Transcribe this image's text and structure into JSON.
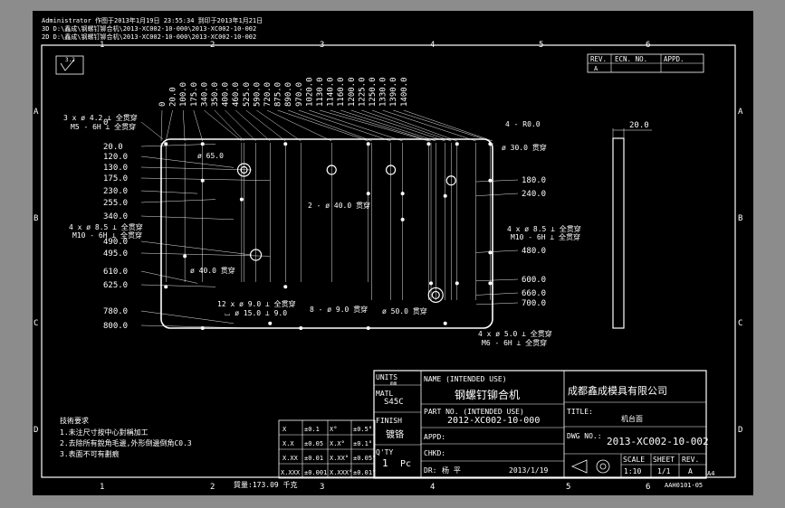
{
  "header": {
    "line1": "Administrator 作图于2013年1月19日 23:55:34 到印于2013年1月21日",
    "line2": "3D  D:\\鑫成\\钢螺钉铆合机\\2013-XC002-10-000\\2013-XC002-10-002",
    "line3": "2D  D:\\鑫成\\钢螺钉铆合机\\2013-XC002-10-000\\2013-XC002-10-002"
  },
  "border": {
    "top_cols": [
      "1",
      "2",
      "3",
      "4",
      "5",
      "6"
    ],
    "bottom_cols": [
      "1",
      "2",
      "3",
      "4",
      "5",
      "6"
    ],
    "left_rows": [
      "A",
      "B",
      "C",
      "D"
    ],
    "right_rows": [
      "A",
      "B",
      "C",
      "D"
    ]
  },
  "surface_mark": "3.2",
  "rev_table": {
    "rev": "REV.",
    "ecn": "ECN. NO.",
    "appd": "APPD.",
    "rev_value": "A"
  },
  "x_dims": [
    "0",
    "20.0",
    "100.0",
    "175.0",
    "340.0",
    "350.0",
    "400.0",
    "460.0",
    "525.0",
    "590.0",
    "720.0",
    "875.0",
    "890.0",
    "970.0",
    "1020.0",
    "1130.0",
    "1140.0",
    "1160.0",
    "1200.0",
    "1225.0",
    "1250.0",
    "1330.0",
    "1390.0",
    "1400.0"
  ],
  "y_dims_left": [
    "0",
    "20.0",
    "120.0",
    "130.0",
    "175.0",
    "230.0",
    "255.0",
    "340.0",
    "490.0",
    "495.0",
    "610.0",
    "625.0",
    "780.0",
    "800.0"
  ],
  "y_dims_right": [
    "180.0",
    "240.0",
    "480.0",
    "600.0",
    "660.0",
    "700.0"
  ],
  "notes": {
    "n1a": "3 x ø 4.2 ⊥ 全贯穿",
    "n1b": "M5 - 6H ⊥ 全贯穿",
    "n2": "4 - R0.0",
    "n3": "ø 30.0 贯穿",
    "n4": "ø 65.0",
    "n5": "2 - ø 40.0 贯穿",
    "n6a": "4 x ø 8.5 ⊥ 全贯穿",
    "n6b": "M10 - 6H ⊥ 全贯穿",
    "n7a": "4 x ø 8.5 ⊥ 全贯穿",
    "n7b": "M10 - 6H ⊥ 全贯穿",
    "n8": "ø 40.0 贯穿",
    "n9a": "12 x ø 9.0 ⊥ 全贯穿",
    "n9b": "⌴ ø 15.0 ⊥ 9.0",
    "n10": "8 - ø 9.0 贯穿",
    "n11": "ø 50.0 贯穿",
    "n12a": "4 x ø 5.0 ⊥ 全贯穿",
    "n12b": "M6 - 6H ⊥ 全贯穿"
  },
  "side_dim": "20.0",
  "tech": {
    "title": "技術要求",
    "l1": "1.未注尺寸按中心對稱加工",
    "l2": "2.去除所有銳角毛邊,外形倒邊倒角C0.3",
    "l3": "3.表面不可有劃痕"
  },
  "weight": "質量:173.09 千克",
  "tol": {
    "r1": [
      "X",
      "±0.1",
      "X°",
      "±0.5°"
    ],
    "r2": [
      "X.X",
      "±0.05",
      "X.X°",
      "±0.1°"
    ],
    "r3": [
      "X.XX",
      "±0.01",
      "X.XX°",
      "±0.05°"
    ],
    "r4": [
      "X.XXX",
      "±0.001",
      "X.XXX°",
      "±0.01°"
    ]
  },
  "title_block": {
    "units_label": "UNITS",
    "units_value": "mm",
    "matl_label": "MATL",
    "matl_value": "S45C",
    "finish_label": "FINISH",
    "finish_value": "镀铬",
    "qty_label": "Q'TY",
    "qty_value": "1",
    "qty_unit": "Pc",
    "name_label": "NAME (INTENDED USE)",
    "name_value": "钢螺钉铆合机",
    "partno_label": "PART NO. (INTENDED USE)",
    "partno_value": "2012-XC002-10-000",
    "appd_label": "APPD:",
    "chkd_label": "CHKD:",
    "dr_label": "DR:",
    "dr_name": "杨   平",
    "date": "2013/1/19",
    "company": "成都鑫成模具有限公司",
    "title_label": "TITLE:",
    "title_value": "机台面",
    "dwg_label": "DWG NO.:",
    "dwg_value": "2013-XC002-10-002",
    "scale_label": "SCALE",
    "sheet_label": "SHEET",
    "rev_label": "REV.",
    "scale_value": "1:10",
    "sheet_value": "1/1",
    "rev_value": "A",
    "size": "A4",
    "form_no": "AAH0101-05"
  }
}
